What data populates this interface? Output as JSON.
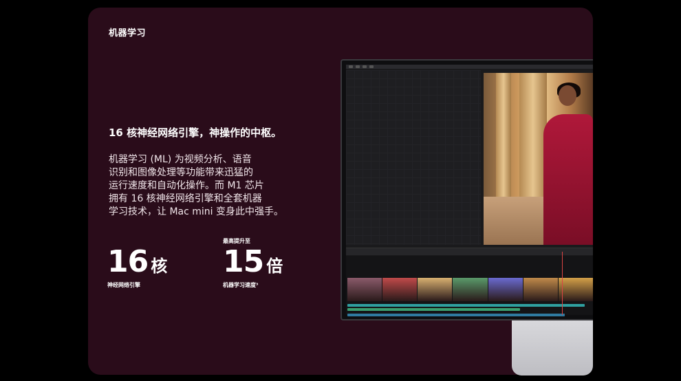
{
  "section": {
    "eyebrow": "机器学习",
    "headline": "16 核神经网络引擎，神操作的中枢。",
    "body_lines": [
      "机器学习 (ML) 为视频分析、语音",
      "识别和图像处理等功能带来迅猛的",
      "运行速度和自动化操作。而 M1 芯片",
      "拥有 16 核神经网络引擎和全套机器",
      "学习技术，让 Mac mini 变身此中强手。"
    ]
  },
  "stats": [
    {
      "label_top": "",
      "number": "16",
      "unit": "核",
      "label": "神经网络引擎"
    },
    {
      "label_top": "最高提升至",
      "number": "15",
      "unit": "倍",
      "label": "机器学习速度³"
    }
  ],
  "colors": {
    "page_bg": "#000000",
    "card_bg": "#2a0c1a",
    "text": "#ffffff"
  },
  "monitor": {
    "app": "video-editor",
    "clip_colors": [
      "#8a5a6a",
      "#c04a4a",
      "#d8b070",
      "#5a9a6a",
      "#6a6ad0",
      "#c08a4a",
      "#d4a048"
    ],
    "track_colors": [
      "#2fa0a0",
      "#3aa070",
      "#2f7aa0"
    ]
  }
}
